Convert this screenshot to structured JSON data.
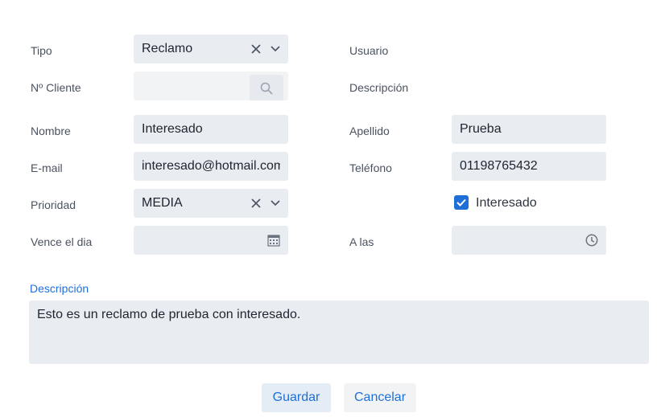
{
  "form": {
    "tipo": {
      "label": "Tipo",
      "value": "Reclamo"
    },
    "cliente": {
      "label": "Nº Cliente",
      "value": ""
    },
    "nombre": {
      "label": "Nombre",
      "value": "Interesado"
    },
    "email": {
      "label": "E-mail",
      "value": "interesado@hotmail.com"
    },
    "prioridad": {
      "label": "Prioridad",
      "value": "MEDIA"
    },
    "vence": {
      "label": "Vence el dia",
      "value": ""
    },
    "usuario": {
      "label": "Usuario"
    },
    "descripcion_right": {
      "label": "Descripción"
    },
    "apellido": {
      "label": "Apellido",
      "value": "Prueba"
    },
    "telefono": {
      "label": "Teléfono",
      "value": "01198765432"
    },
    "interesado": {
      "label": "Interesado",
      "checked": true
    },
    "a_las": {
      "label": "A las",
      "value": ""
    },
    "descripcion": {
      "label": "Descripción",
      "value": "Esto es un reclamo de prueba con interesado."
    }
  },
  "buttons": {
    "save": "Guardar",
    "cancel": "Cancelar"
  },
  "icons": [
    "clear-icon",
    "chevron-down-icon",
    "search-icon",
    "calendar-icon",
    "clock-icon",
    "check-icon"
  ],
  "colors": {
    "accent": "#1f6fd9",
    "field_bg": "#e9ecf1"
  }
}
